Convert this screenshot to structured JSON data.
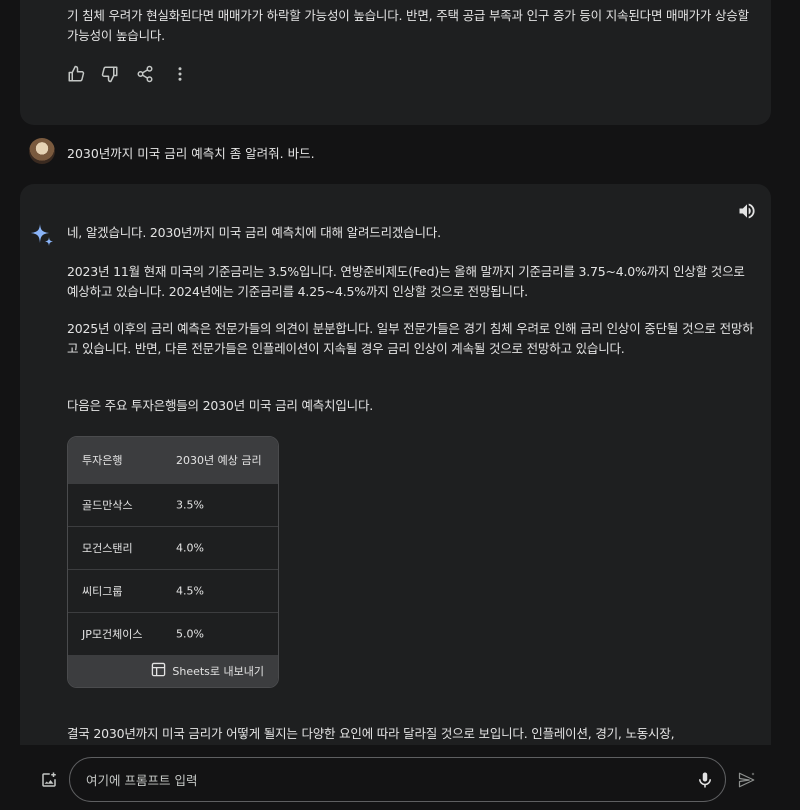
{
  "previous_response": {
    "text": "기 침체 우려가 현실화된다면 매매가가 하락할 가능성이 높습니다. 반면, 주택 공급 부족과 인구 증가 등이 지속된다면 매매가가 상승할 가능성이 높습니다.",
    "actions": [
      "thumbs-up-icon",
      "thumbs-down-icon",
      "share-icon",
      "more-vert-icon"
    ]
  },
  "user_message": {
    "text": "2030년까지 미국 금리 예측치 좀 알려줘. 바드."
  },
  "response": {
    "intro": "네, 알겠습니다. 2030년까지 미국 금리 예측치에 대해 알려드리겠습니다.",
    "p1": "2023년 11월 현재 미국의 기준금리는 3.5%입니다. 연방준비제도(Fed)는 올해 말까지 기준금리를 3.75~4.0%까지 인상할 것으로 예상하고 있습니다. 2024년에는 기준금리를 4.25~4.5%까지 인상할 것으로 전망됩니다.",
    "p2": "2025년 이후의 금리 예측은 전문가들의 의견이 분분합니다. 일부 전문가들은 경기 침체 우려로 인해 금리 인상이 중단될 것으로 전망하고 있습니다. 반면, 다른 전문가들은 인플레이션이 지속될 경우 금리 인상이 계속될 것으로 전망하고 있습니다.",
    "p3": "다음은 주요 투자은행들의 2030년 미국 금리 예측치입니다.",
    "table": {
      "headers": [
        "투자은행",
        "2030년 예상 금리"
      ],
      "rows": [
        [
          "골드만삭스",
          "3.5%"
        ],
        [
          "모건스탠리",
          "4.0%"
        ],
        [
          "씨티그룹",
          "4.5%"
        ],
        [
          "JP모건체이스",
          "5.0%"
        ]
      ],
      "export_label": "Sheets로 내보내기"
    },
    "p4": "결국 2030년까지 미국 금리가 어떻게 될지는 다양한 요인에 따라 달라질 것으로 보입니다. 인플레이션, 경기, 노동시장,"
  },
  "input": {
    "placeholder": "여기에 프롬프트 입력"
  },
  "colors": {
    "background": "#131314",
    "card": "#1e1f20",
    "text": "#e3e3e3",
    "gemini_blue": "#8ab4f8"
  }
}
